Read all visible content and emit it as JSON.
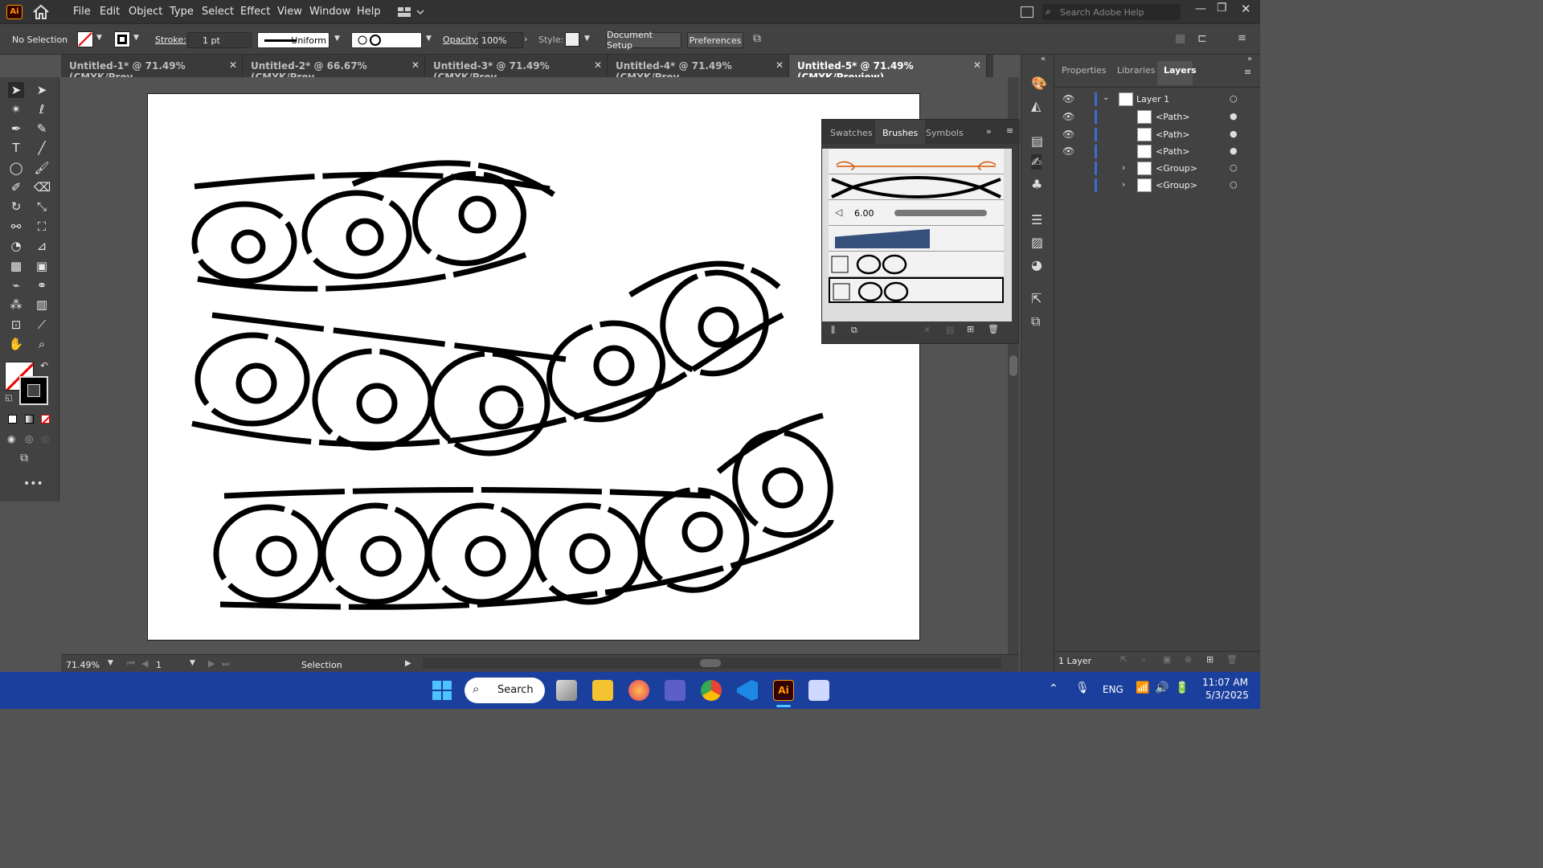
{
  "menubar": {
    "app_badge": "Ai",
    "items": [
      "File",
      "Edit",
      "Object",
      "Type",
      "Select",
      "Effect",
      "View",
      "Window",
      "Help"
    ],
    "search_placeholder": "Search Adobe Help"
  },
  "control": {
    "selection": "No Selection",
    "stroke_label": "Stroke:",
    "stroke_value": "1 pt",
    "profile": "Uniform",
    "opacity_label": "Opacity:",
    "opacity_value": "100%",
    "style_label": "Style:",
    "doc_setup": "Document Setup",
    "preferences": "Preferences"
  },
  "tabs": [
    {
      "label": "Untitled-1* @ 71.49% (CMYK/Prev...",
      "active": false
    },
    {
      "label": "Untitled-2* @ 66.67% (CMYK/Prev...",
      "active": false
    },
    {
      "label": "Untitled-3* @ 71.49% (CMYK/Prev...",
      "active": false
    },
    {
      "label": "Untitled-4* @ 71.49% (CMYK/Prev...",
      "active": false
    },
    {
      "label": "Untitled-5* @ 71.49% (CMYK/Preview)",
      "active": true
    }
  ],
  "status": {
    "zoom": "71.49%",
    "page": "1",
    "tool": "Selection"
  },
  "brushes_panel": {
    "tabs": [
      "Swatches",
      "Brushes",
      "Symbols"
    ],
    "active_tab": "Brushes",
    "calligraphic_size": "6.00"
  },
  "layers_panel": {
    "tabs": [
      "Properties",
      "Libraries",
      "Layers"
    ],
    "active_tab": "Layers",
    "rows": [
      "Layer 1",
      "<Path>",
      "<Path>",
      "<Path>",
      "<Group>",
      "<Group>"
    ],
    "footer": "1 Layer"
  },
  "taskbar": {
    "search": "Search",
    "lang": "ENG",
    "time": "11:07 AM",
    "date": "5/3/2025"
  }
}
